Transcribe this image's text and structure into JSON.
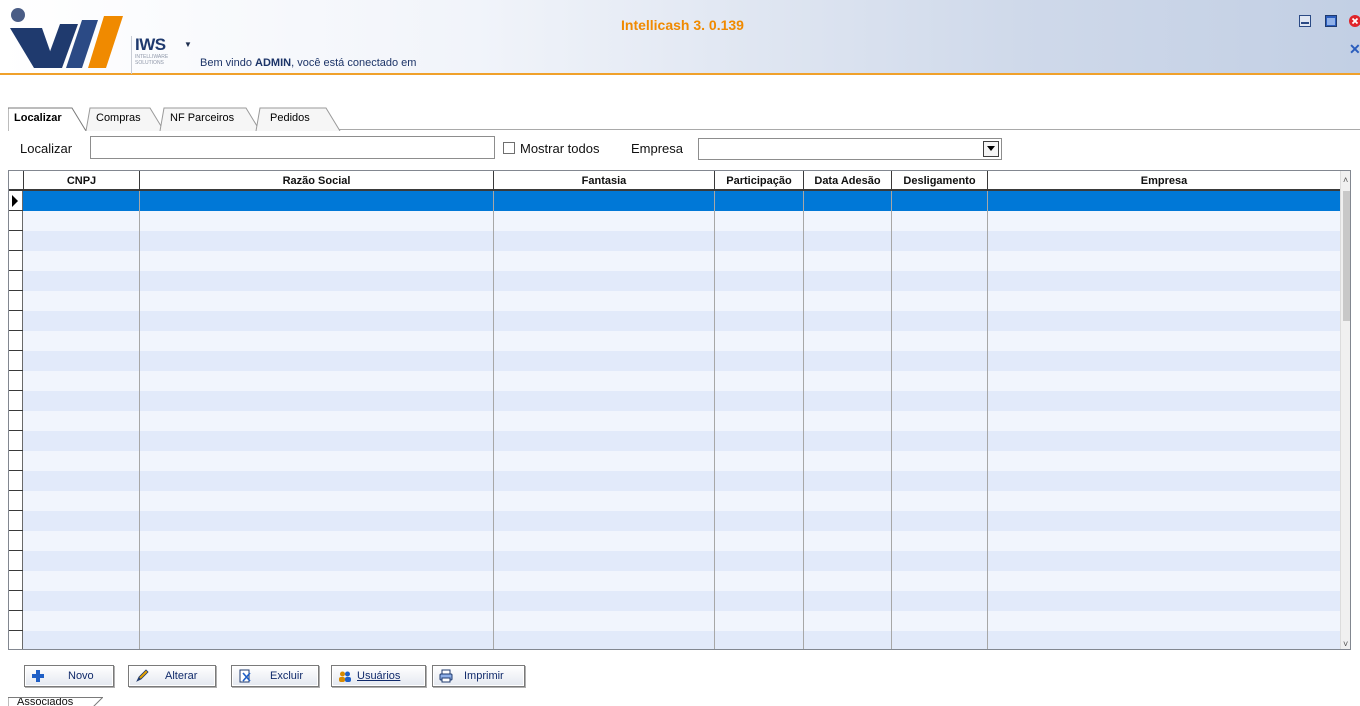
{
  "header": {
    "app_title": "Intellicash 3. 0.139",
    "brand_main": "IWS",
    "brand_sub": "INTELLIWARE SOLUTIONS",
    "welcome_prefix": "Bem vindo ",
    "welcome_user": "ADMIN",
    "welcome_suffix": ", você está conectado em",
    "accent_color": "#f0a12b"
  },
  "tabs": [
    {
      "label": "Localizar",
      "active": true
    },
    {
      "label": "Compras",
      "active": false
    },
    {
      "label": "NF Parceiros",
      "active": false
    },
    {
      "label": "Pedidos",
      "active": false
    }
  ],
  "filters": {
    "search_label": "Localizar",
    "search_value": "",
    "show_all_label": "Mostrar todos",
    "show_all_checked": false,
    "company_label": "Empresa",
    "company_value": ""
  },
  "grid": {
    "columns": [
      "CNPJ",
      "Razão Social",
      "Fantasia",
      "Participação",
      "Data Adesão",
      "Desligamento",
      "Empresa"
    ],
    "selected_row": 1,
    "row_count": 23,
    "selection_color": "#0078d7"
  },
  "buttons": {
    "new": "Novo",
    "edit": "Alterar",
    "delete": "Excluir",
    "users": "Usuários",
    "print": "Imprimir"
  },
  "bottom_tab": {
    "label": "Associados"
  }
}
